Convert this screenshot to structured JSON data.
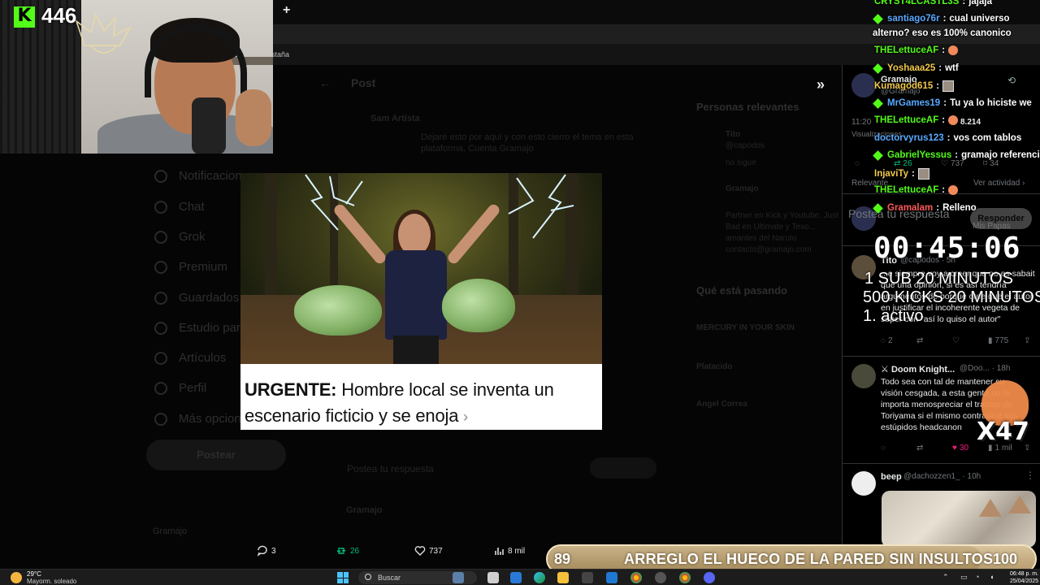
{
  "stream": {
    "viewer_count": "446",
    "platform_logo": "K"
  },
  "browser": {
    "new_tab": "+",
    "bookmark_text": "staña"
  },
  "left_nav": [
    {
      "label": "Notificaciones",
      "icon": "bell-icon"
    },
    {
      "label": "Chat",
      "icon": "chat-icon"
    },
    {
      "label": "Grok",
      "icon": "grok-icon"
    },
    {
      "label": "Premium",
      "icon": "premium-icon"
    },
    {
      "label": "Guardados",
      "icon": "bookmark-icon"
    },
    {
      "label": "Estudio para",
      "icon": "studio-icon"
    },
    {
      "label": "Artículos",
      "icon": "articles-icon"
    },
    {
      "label": "Perfil",
      "icon": "profile-icon"
    },
    {
      "label": "Más opciones",
      "icon": "more-icon"
    }
  ],
  "post_button": "Postear",
  "dim_post": {
    "back": "←",
    "title": "Post",
    "author": "Sam Artista",
    "text_line1": "Dejaré esto por aquí y con esto cierro el tema en esta",
    "text_line2": "plataforma. Cuenta Gramajo",
    "reply_placeholder": "Postea tu respuesta",
    "profile_name": "Gramajo",
    "reply_author": "Gramajo"
  },
  "dim_right": {
    "relevant_people_title": "Personas relevantes",
    "person1": "Tito",
    "person1_sub": "@capodos",
    "person1_follow": "no sigue",
    "person2": "Gramajo",
    "person2_bio_1": "Partner en Kick y Youtube. Just",
    "person2_bio_2": "Bad en Ultimate y Teso...",
    "person2_bio_3": "amantes del Naruto",
    "person2_bio_4": "contacto@gramajo.com",
    "trending_title": "Qué está pasando",
    "trend1": "MERCURY IN YOUR SKIN",
    "trend2": "Platacido",
    "trend3": "Angel Correa"
  },
  "stats": {
    "replies": "3",
    "retweets": "26",
    "likes": "737",
    "views": "8 mil"
  },
  "meme": {
    "caption_bold": "URGENTE:",
    "caption_rest_line1": " Hombre local se inventa un",
    "caption_line2": "escenario ficticio y se enoja",
    "chevron": "›"
  },
  "twitter_panel": {
    "main_author": "Gramajo",
    "main_handle": "@Gramajo",
    "time": "11:20",
    "views_label": "Visualizaciones",
    "views_count": "8.214",
    "relevant_label": "Relevante",
    "see_activity": "Ver actividad ›",
    "reply_placeholder": "Postea tu respuesta",
    "reply_button": "Responder",
    "replying_to": "Mis Papas",
    "main_actions": {
      "replies": "",
      "retweets": "26",
      "likes": "737",
      "views": "34"
    },
    "tweets": [
      {
        "name": "Tito",
        "handle": "@capodos · 5h",
        "text_1": "...e siempre voy a creer que no es sabait",
        "text_2": "que una opinión, si es así tendría",
        "text_3": "argumentos de porque cree que el autor",
        "text_4": "en justificar el incoherente vegeta de",
        "text_5": "super con \"así lo quiso el autor\"",
        "replies": "2",
        "retweets": "",
        "likes": "",
        "views": "775"
      },
      {
        "name": "Doom Knight...",
        "handle": "@Doo... · 18h",
        "text_1": "Todo sea con tal de mantener su",
        "text_2": "visión cesgada, a esta gente no le",
        "text_3": "importa menospreciar el trabajo de",
        "text_4": "Toriyama si el mismo contradice sus",
        "text_5": "estúpidos headcanon",
        "replies": "",
        "retweets": "",
        "likes": "30",
        "views": "1 mil"
      },
      {
        "name": "beep",
        "handle": "@dachozzen1_ · 10h"
      }
    ]
  },
  "chat": [
    {
      "user": "CRYST4LCASTL3S",
      "color": "#53fc18",
      "msg": "jajaja",
      "badge": false
    },
    {
      "user": "santiago76r",
      "color": "#5aa9ff",
      "msg": "cual universo",
      "badge": true
    },
    {
      "user": "",
      "color": "#ffffff",
      "msg": "alterno? eso es 100% canonico",
      "badge": false
    },
    {
      "user": "THELettuceAF",
      "color": "#53fc18",
      "msg": "",
      "badge": false,
      "emote": "peach"
    },
    {
      "user": "Yoshaaa25",
      "color": "#f2c94c",
      "msg": "wtf",
      "badge": true
    },
    {
      "user": "Kumagod615",
      "color": "#f2c94c",
      "msg": "",
      "badge": false,
      "emote": "square"
    },
    {
      "user": "MrGames19",
      "color": "#5aa9ff",
      "msg": "Tu ya lo hiciste we",
      "badge": true
    },
    {
      "user": "THELettuceAF",
      "color": "#53fc18",
      "msg": "",
      "badge": false,
      "emote": "peach"
    },
    {
      "user": "doctorvyrus123",
      "color": "#5aa9ff",
      "msg": "vos com tablos",
      "badge": false
    },
    {
      "user": "GabrielYessus",
      "color": "#53fc18",
      "msg": "gramajo referencia",
      "badge": true
    },
    {
      "user": "InjaviTy",
      "color": "#f2c94c",
      "msg": "",
      "badge": false,
      "emote": "square"
    },
    {
      "user": "THELettuceAF",
      "color": "#53fc18",
      "msg": "",
      "badge": false,
      "emote": "peach"
    },
    {
      "user": "Gramalam",
      "color": "#ff5a5a",
      "msg": "Relleno",
      "badge": true
    }
  ],
  "timer": {
    "time": "00:45:06",
    "line1": "1 SUB 20 MINUTOS",
    "line2": "500 KICKS 20 MINUTOS",
    "line3": "1. activo"
  },
  "overlay_badge": "X47",
  "goal": {
    "current": "89",
    "text": "ARREGLO EL HUECO DE LA PARED SIN INSULTOS",
    "target": "100",
    "progress": 0.89
  },
  "taskbar": {
    "temp": "29°C",
    "weather": "Mayorm. soleado",
    "search_label": "Buscar",
    "time": "06:48 p. m.",
    "date": "25/04/2025"
  },
  "colors": {
    "kick_green": "#53fc18",
    "twitter_bg": "#000000",
    "like_pink": "#f91880",
    "retweet_green": "#00ba7c",
    "goal_bar": "#c9b287"
  }
}
